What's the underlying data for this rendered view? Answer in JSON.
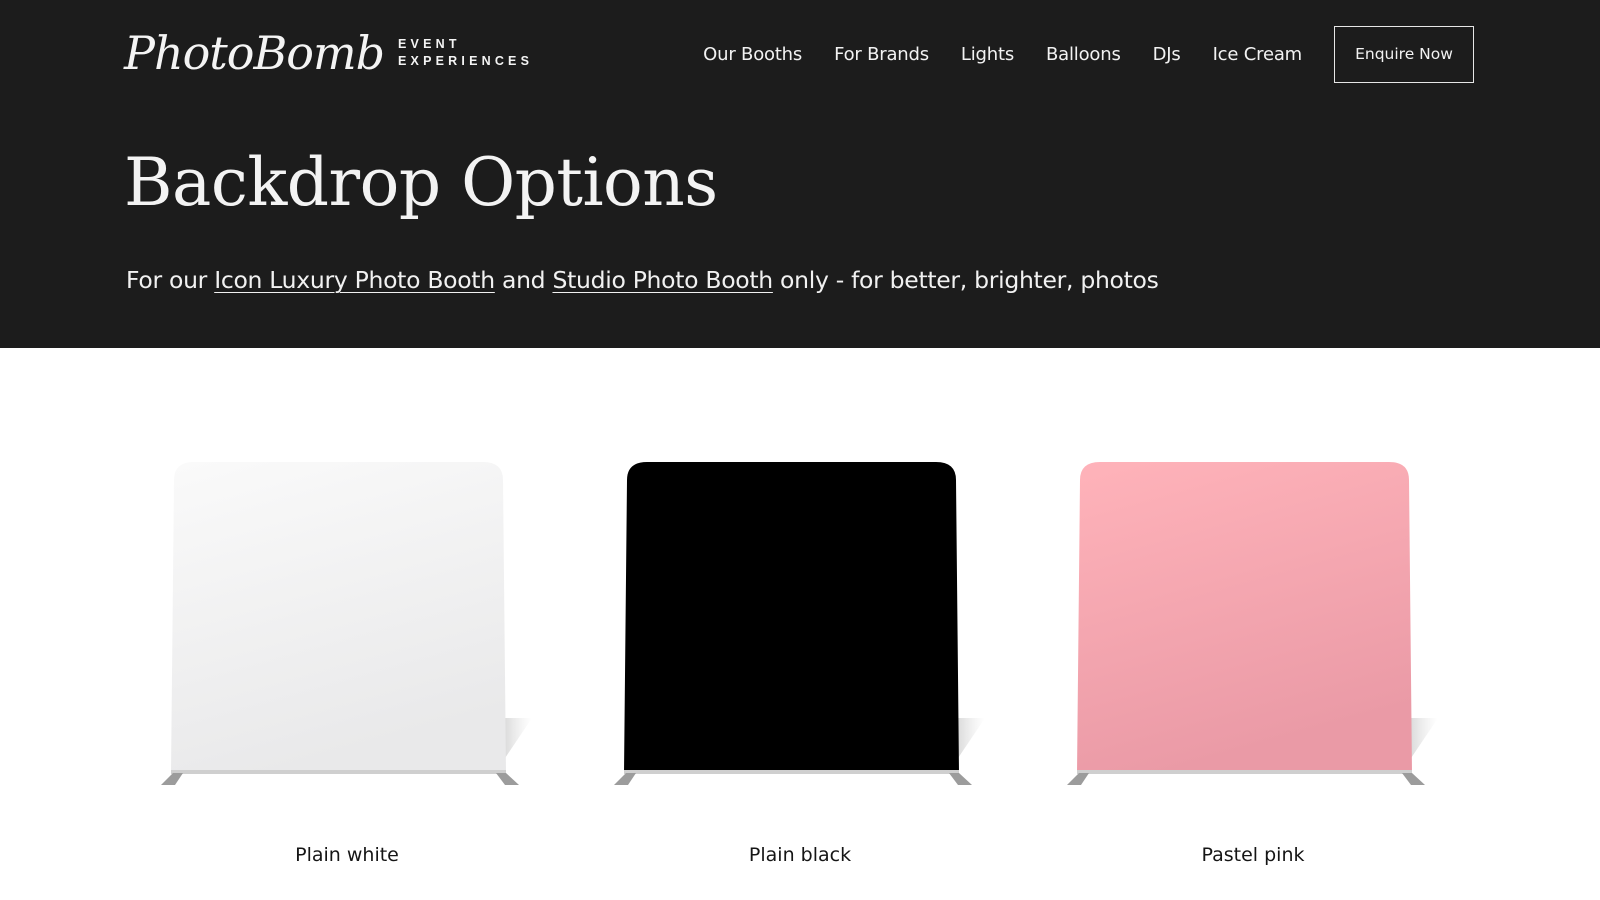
{
  "header": {
    "logo_script": "PhotoBomb",
    "logo_line1": "EVENT",
    "logo_line2": "EXPERIENCES",
    "nav": [
      {
        "label": "Our Booths"
      },
      {
        "label": "For Brands"
      },
      {
        "label": "Lights"
      },
      {
        "label": "Balloons"
      },
      {
        "label": "DJs"
      },
      {
        "label": "Ice Cream"
      }
    ],
    "cta_label": "Enquire Now"
  },
  "hero": {
    "title": "Backdrop Options",
    "subtitle_prefix": "For our ",
    "link1": "Icon Luxury Photo Booth",
    "subtitle_mid": " and ",
    "link2": "Studio Photo Booth",
    "subtitle_suffix": " only - for better, brighter, photos"
  },
  "backdrops": [
    {
      "label": "Plain white",
      "color_top": "#fafafa",
      "color_bottom": "#e9e9ea"
    },
    {
      "label": "Plain black",
      "color_top": "#000000",
      "color_bottom": "#000000"
    },
    {
      "label": "Pastel pink",
      "color_top": "#ffb3ba",
      "color_bottom": "#ea9aa6"
    }
  ],
  "colors": {
    "hero_bg": "#1c1c1c",
    "hero_text": "#f3f3f3",
    "page_bg": "#ffffff"
  }
}
